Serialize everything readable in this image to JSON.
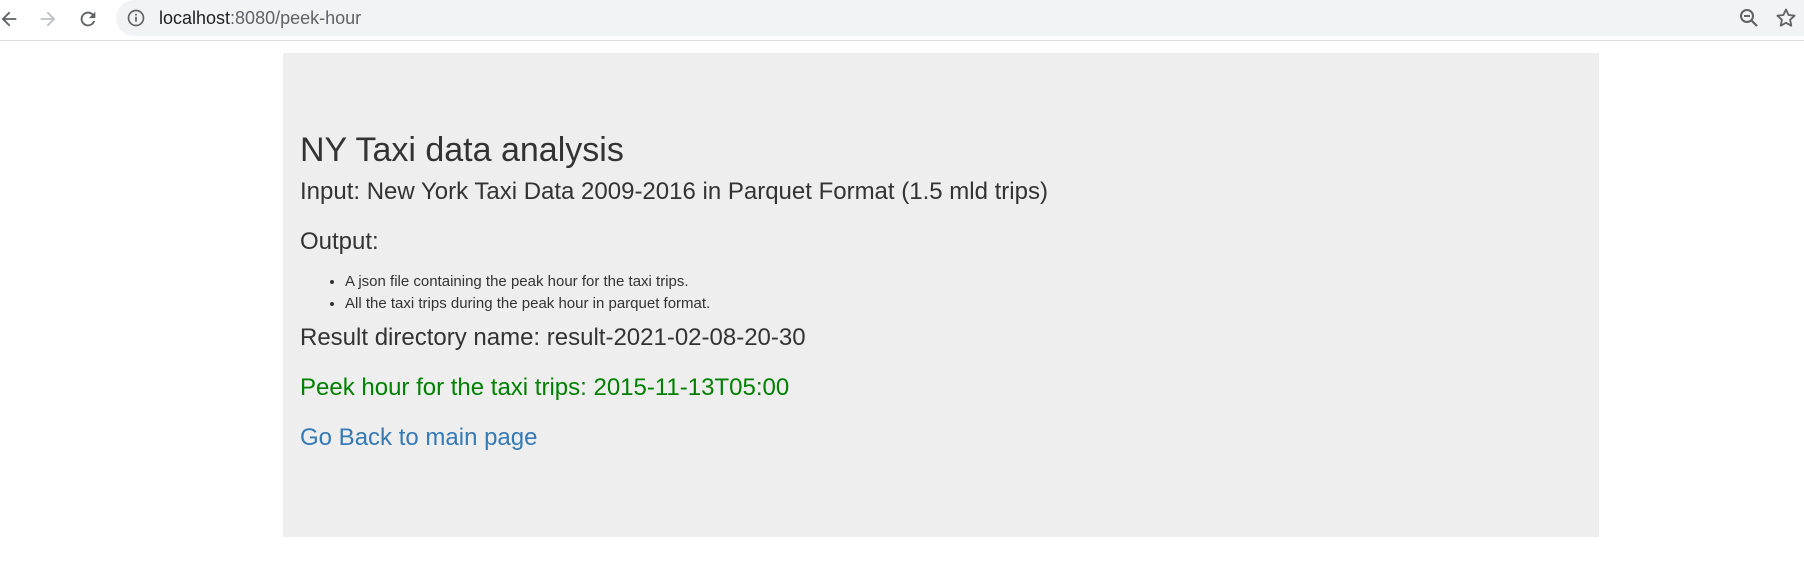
{
  "browser": {
    "url_host": "localhost",
    "url_rest": ":8080/peek-hour"
  },
  "page": {
    "title": "NY Taxi data analysis",
    "input": "Input: New York Taxi Data 2009-2016 in Parquet Format (1.5 mld trips)",
    "output_label": "Output:",
    "output_items": [
      "A json file containing the peak hour for the taxi trips.",
      "All the taxi trips during the peak hour in parquet format."
    ],
    "result_directory": "Result directory name: result-2021-02-08-20-30",
    "peak_hour": "Peek hour for the taxi trips: 2015-11-13T05:00",
    "back_link": "Go Back to main page"
  },
  "colors": {
    "success": "#008000",
    "link": "#337ab7",
    "jumbotron_bg": "#eeeeee"
  },
  "icons": [
    "back-arrow-icon",
    "forward-arrow-icon",
    "reload-icon",
    "info-icon",
    "zoom-icon",
    "star-icon"
  ]
}
